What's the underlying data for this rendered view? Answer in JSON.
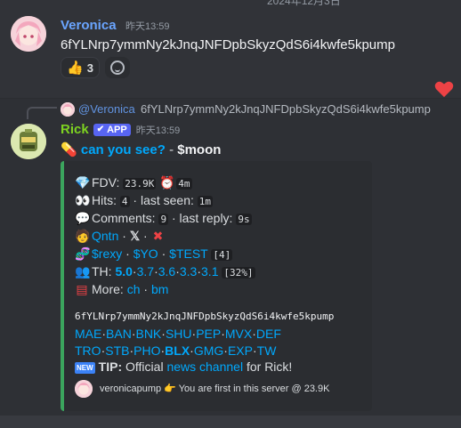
{
  "date_divider": "2024年12月3日",
  "message1": {
    "author": "Veronica",
    "timestamp": "昨天13:59",
    "content": "6fYLNrp7ymmNy2kJnqJNFDpbSkyzQdS6i4kwfe5kpump",
    "reactions": [
      {
        "emoji": "👍",
        "count": "3"
      }
    ],
    "colors": {
      "author": "#6aa5ff"
    }
  },
  "message2": {
    "reply": {
      "author": "@Veronica",
      "text": "6fYLNrp7ymmNy2kJnqJNFDpbSkyzQdS6i4kwfe5kpump"
    },
    "author": "Rick",
    "badge": "APP",
    "timestamp": "昨天13:59",
    "line": {
      "pill_icon": "pill-icon",
      "link": "can you see?",
      "separator": " - ",
      "ticker": "$moon"
    },
    "colors": {
      "author": "#7ed321",
      "embed_border": "#3ba55d",
      "link": "#00a8fc"
    }
  },
  "embed": {
    "fdv_label": "FDV:",
    "fdv_value": "23.9K",
    "age_value": "4m",
    "hits_label": "Hits:",
    "hits_value": "4",
    "last_seen_label": "· last seen:",
    "last_seen_value": "1m",
    "comments_label": "Comments:",
    "comments_value": "9",
    "last_reply_label": "· last reply:",
    "last_reply_value": "9s",
    "qntn_link": "Qntn",
    "x_link": "𝕏",
    "tickers": [
      "$rexy",
      "$YO",
      "$TEST"
    ],
    "tickers_count": "[4]",
    "th_label": "TH:",
    "th_values": [
      "5.0",
      "3.7",
      "3.6",
      "3.3",
      "3.1"
    ],
    "th_pct": "[32%]",
    "more_label": "More:",
    "more_links": [
      "ch",
      "bm"
    ],
    "ca": "6fYLNrp7ymmNy2kJnqJNFDpbSkyzQdS6i4kwfe5kpump",
    "links_row1": [
      "MAE",
      "BAN",
      "BNK",
      "SHU",
      "PEP",
      "MVX",
      "DEF"
    ],
    "links_row2": [
      "TRO",
      "STB",
      "PHO",
      "BLX",
      "GMG",
      "EXP",
      "TW"
    ],
    "tip_badge": "NEW",
    "tip_label": "TIP:",
    "tip_text": "Official",
    "tip_link": "news channel",
    "tip_suffix": "for Rick!",
    "footer_user": "veronicapump",
    "footer_text": "You are first in this server @ 23.9K"
  }
}
